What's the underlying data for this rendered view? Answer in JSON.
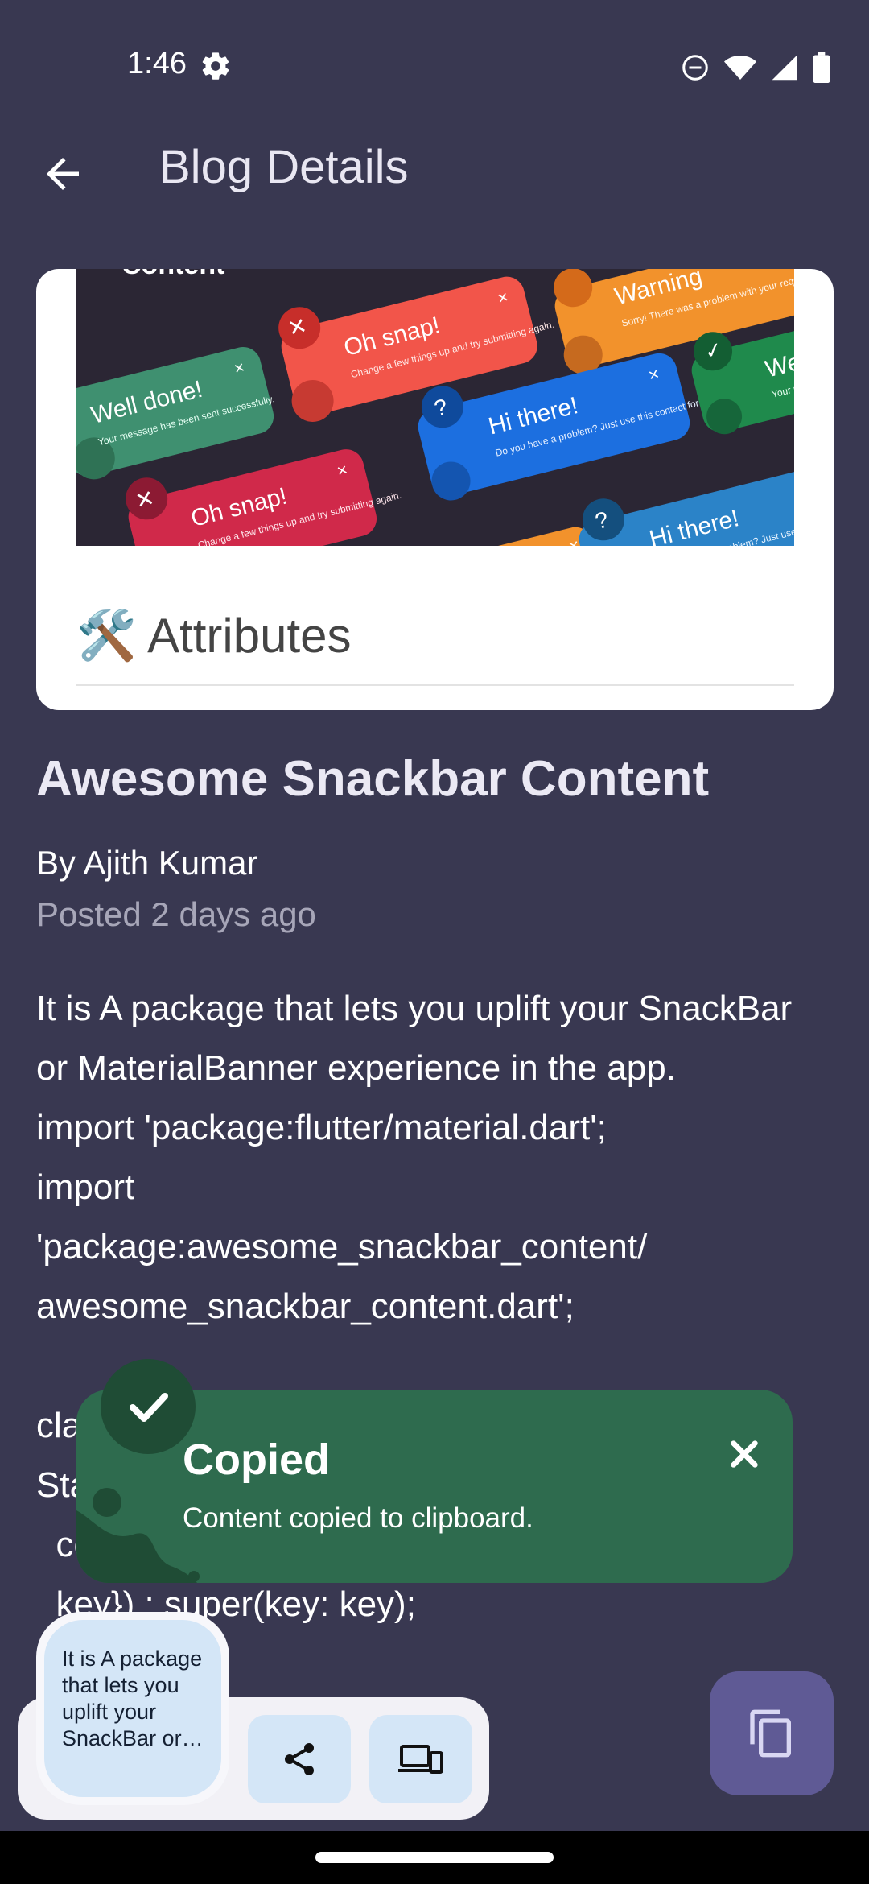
{
  "status": {
    "time": "1:46"
  },
  "appbar": {
    "title": "Blog Details"
  },
  "card": {
    "banner": {
      "top_text": "Content",
      "toasts": [
        {
          "title": "Well done!",
          "body": "Your message has been sent successfully.",
          "color": "#3f9070"
        },
        {
          "title": "Oh snap!",
          "body": "Change a few things up and try submitting again.",
          "color": "#f2554a"
        },
        {
          "title": "Warning",
          "body": "Sorry! There was a problem with your request.",
          "color": "#f2922c"
        },
        {
          "title": "Hi there!",
          "body": "Do you have a problem? Just use this contact form.",
          "color": "#1c6fe0"
        },
        {
          "title": "Well",
          "body": "Your me success",
          "color": "#1f8a4c"
        },
        {
          "title": "Oh snap!",
          "body": "Change a few things up and try submitting again.",
          "color": "#d0294a"
        },
        {
          "title": "Hi there!",
          "body": "Do you have a problem? Just use this contact form.",
          "color": "#2b83c8"
        }
      ]
    },
    "attributes_label": "🛠️ Attributes"
  },
  "post": {
    "title": "Awesome Snackbar Content",
    "author": "By Ajith Kumar",
    "posted": "Posted 2 days ago",
    "body": "It is A package that lets you uplift your SnackBar or MaterialBanner experience in the app.\nimport 'package:flutter/material.dart';\nimport\n'package:awesome_snackbar_content/\nawesome_snackbar_content.dart';\n\nclass AwesomeSnackbarExample extends\nStatelessWidget {\n  const AwesomeSnackbarExample({Key?\n  key}) : super(key: key);"
  },
  "snackbar": {
    "title": "Copied",
    "message": "Content copied to clipboard.",
    "color": "#2e6b4e"
  },
  "share_sheet": {
    "preview_text": "It is A package that lets you uplift your SnackBar or…"
  },
  "colors": {
    "background": "#393851",
    "fab": "#5f5a95",
    "chip": "#d4e6f7"
  }
}
